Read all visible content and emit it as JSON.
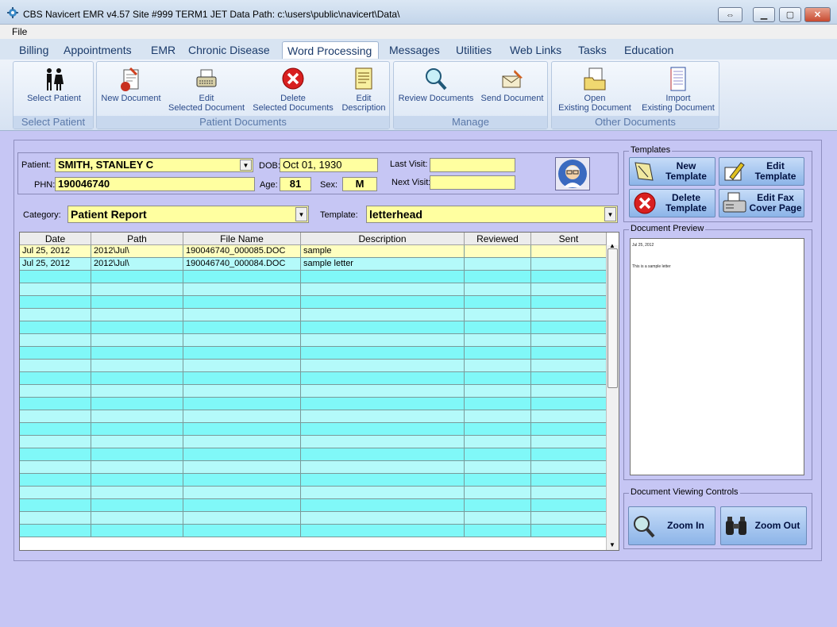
{
  "window": {
    "title": "CBS Navicert EMR v4.57 Site #999 TERM1  JET  Data Path: c:\\users\\public\\navicert\\Data\\"
  },
  "menu": {
    "file": "File"
  },
  "tabs": [
    "Billing",
    "Appointments",
    "EMR",
    "Chronic Disease",
    "Word Processing",
    "Messages",
    "Utilities",
    "Web Links",
    "Tasks",
    "Education"
  ],
  "ribbon": {
    "select_patient": {
      "button": "Select Patient",
      "group": "Select Patient"
    },
    "patient_documents": {
      "group": "Patient Documents",
      "new_document": "New Document",
      "edit_line1": "Edit",
      "edit_line2": "Selected Document",
      "delete_line1": "Delete",
      "delete_line2": "Selected Documents",
      "editdesc_line1": "Edit",
      "editdesc_line2": "Description"
    },
    "manage": {
      "group": "Manage",
      "review": "Review Documents",
      "send": "Send Document"
    },
    "other": {
      "group": "Other Documents",
      "open_line1": "Open",
      "open_line2": "Existing Document",
      "import_line1": "Import",
      "import_line2": "Existing Document"
    }
  },
  "patient": {
    "patient_label": "Patient:",
    "patient_value": "SMITH, STANLEY C",
    "phn_label": "PHN:",
    "phn_value": "190046740",
    "dob_label": "DOB:",
    "dob_value": "Oct 01, 1930",
    "age_label": "Age:",
    "age_value": "81",
    "sex_label": "Sex:",
    "sex_value": "M",
    "last_visit_label": "Last Visit:",
    "last_visit_value": "",
    "next_visit_label": "Next Visit:",
    "next_visit_value": ""
  },
  "filters": {
    "category_label": "Category:",
    "category_value": "Patient Report",
    "template_label": "Template:",
    "template_value": "letterhead"
  },
  "table": {
    "columns": [
      "Date",
      "Path",
      "File Name",
      "Description",
      "Reviewed",
      "Sent"
    ],
    "rows": [
      [
        "Jul 25, 2012",
        "2012\\Jul\\",
        "190046740_000085.DOC",
        "sample",
        "",
        ""
      ],
      [
        "Jul 25, 2012",
        "2012\\Jul\\",
        "190046740_000084.DOC",
        "sample letter",
        "",
        ""
      ]
    ]
  },
  "templates": {
    "legend": "Templates",
    "new_line1": "New",
    "new_line2": "Template",
    "edit_line1": "Edit",
    "edit_line2": "Template",
    "delete_line1": "Delete",
    "delete_line2": "Template",
    "fax_line1": "Edit Fax",
    "fax_line2": "Cover Page"
  },
  "preview": {
    "legend": "Document Preview",
    "line1": "Jul 25, 2012",
    "line2": "This is a sample letter"
  },
  "viewing": {
    "legend": "Document Viewing Controls",
    "zoom_in": "Zoom In",
    "zoom_out": "Zoom Out"
  },
  "colors": {
    "row_selected": "#ffffc0",
    "row_a": "#b4fafa",
    "row_b": "#80f8f8",
    "field": "#ffffa0",
    "background": "#c6c6f4"
  }
}
